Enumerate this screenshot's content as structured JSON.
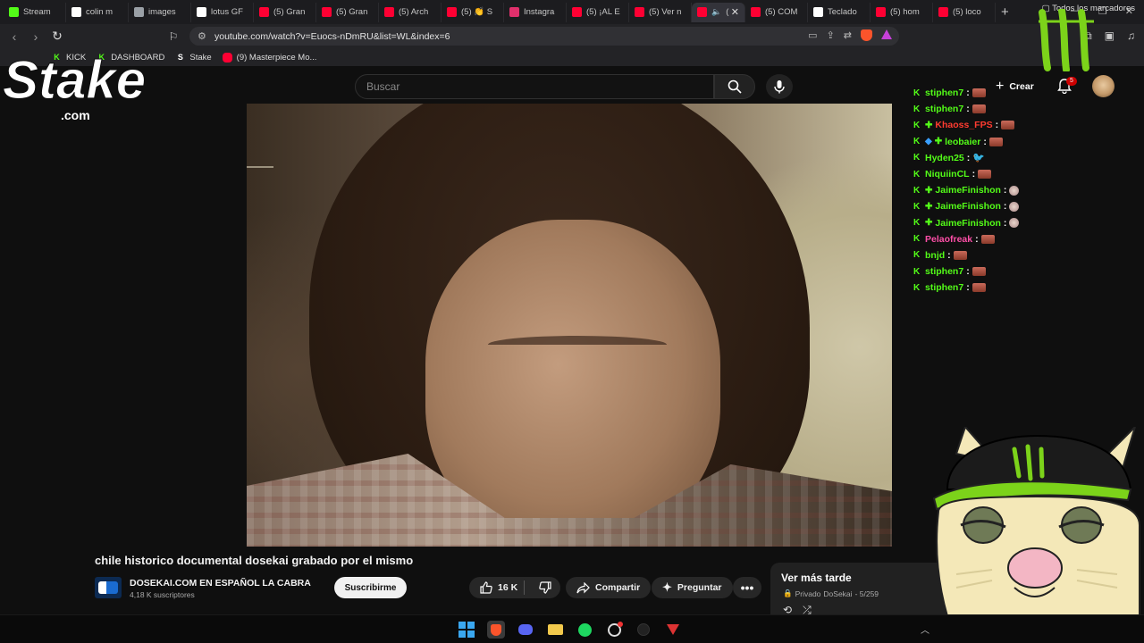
{
  "browser": {
    "tabs": [
      {
        "label": "Stream",
        "icon": "kick-icon",
        "color": "#53fc18"
      },
      {
        "label": "colin m",
        "icon": "google-icon",
        "color": "#ffffff"
      },
      {
        "label": "images",
        "icon": "globe-icon",
        "color": "#9aa0a6"
      },
      {
        "label": "lotus GF",
        "icon": "google-icon",
        "color": "#ffffff"
      },
      {
        "label": "(5) Gran",
        "icon": "youtube-icon",
        "color": "#ff0033"
      },
      {
        "label": "(5) Gran",
        "icon": "youtube-icon",
        "color": "#ff0033"
      },
      {
        "label": "(5) Arch",
        "icon": "youtube-icon",
        "color": "#ff0033"
      },
      {
        "label": "(5) 👏 S",
        "icon": "youtube-icon",
        "color": "#ff0033"
      },
      {
        "label": "Instagra",
        "icon": "instagram-icon",
        "color": "#e1306c"
      },
      {
        "label": "(5) ¡AL E",
        "icon": "youtube-icon",
        "color": "#ff0033"
      },
      {
        "label": "(5) Ver n",
        "icon": "youtube-icon",
        "color": "#ff0033"
      },
      {
        "label": "(",
        "icon": "youtube-icon",
        "color": "#ff0033",
        "active": true
      },
      {
        "label": "(5) COM",
        "icon": "youtube-icon",
        "color": "#ff0033"
      },
      {
        "label": "Teclado",
        "icon": "tiktok-icon",
        "color": "#ffffff"
      },
      {
        "label": "(5) hom",
        "icon": "youtube-icon",
        "color": "#ff0033"
      },
      {
        "label": "(5) loco",
        "icon": "youtube-icon",
        "color": "#ff0033"
      }
    ],
    "url": "youtube.com/watch?v=Euocs-nDmRU&list=WL&index=6",
    "bookmarks": [
      {
        "label": "KICK",
        "icon": "kick-icon",
        "color": "#53fc18"
      },
      {
        "label": "DASHBOARD",
        "icon": "kick-icon",
        "color": "#53fc18"
      },
      {
        "label": "Stake",
        "icon": "stake-icon",
        "color": "#ffffff"
      },
      {
        "label": "(9) Masterpiece Mo...",
        "icon": "youtube-icon",
        "color": "#ff0033"
      }
    ],
    "bookmarks_right": "Todos los marcadores"
  },
  "youtube": {
    "search_placeholder": "Buscar",
    "create_label": "Crear",
    "notif_count": "5",
    "video_title": "chile historico documental dosekai grabado por el mismo",
    "channel_name": "DOSEKAI.COM EN ESPAÑOL LA CABRA",
    "channel_subs": "4,18 K suscriptores",
    "subscribe_label": "Suscribirme",
    "likes": "16 K",
    "share_label": "Compartir",
    "ask_label": "Preguntar",
    "playlist_title": "Ver más tarde",
    "playlist_privacy": "Privado",
    "playlist_owner": "DoSekai",
    "playlist_position": "- 5/259"
  },
  "overlay": {
    "stake_text": "Stake",
    "stake_domain": ".com",
    "chat": [
      {
        "user": "stiphen7",
        "color": "#53fc18",
        "badges": [],
        "emote": "emote"
      },
      {
        "user": "stiphen7",
        "color": "#53fc18",
        "badges": [],
        "emote": "emote"
      },
      {
        "user": "Khaoss_FPS",
        "color": "#ff3b30",
        "badges": [
          "green"
        ],
        "emote": "emote"
      },
      {
        "user": "leobaier",
        "color": "#53fc18",
        "badges": [
          "blue",
          "green"
        ],
        "emote": "emote"
      },
      {
        "user": "Hyden25",
        "color": "#53fc18",
        "badges": [],
        "emote": "bird"
      },
      {
        "user": "NiquiinCL",
        "color": "#53fc18",
        "badges": [],
        "emote": "emote"
      },
      {
        "user": "JaimeFinishon",
        "color": "#53fc18",
        "badges": [
          "green"
        ],
        "emote": "face"
      },
      {
        "user": "JaimeFinishon",
        "color": "#53fc18",
        "badges": [
          "green"
        ],
        "emote": "face"
      },
      {
        "user": "JaimeFinishon",
        "color": "#53fc18",
        "badges": [
          "green"
        ],
        "emote": "face"
      },
      {
        "user": "Pelaofreak",
        "color": "#ff4fa8",
        "badges": [],
        "emote": "emote"
      },
      {
        "user": "bnjd",
        "color": "#53fc18",
        "badges": [],
        "emote": "emote"
      },
      {
        "user": "stiphen7",
        "color": "#53fc18",
        "badges": [],
        "emote": "emote"
      },
      {
        "user": "stiphen7",
        "color": "#53fc18",
        "badges": [],
        "emote": "emote"
      }
    ]
  },
  "colors": {
    "kick_green": "#53fc18",
    "yt_red": "#ff0033",
    "monster_green": "#7cd31a"
  }
}
